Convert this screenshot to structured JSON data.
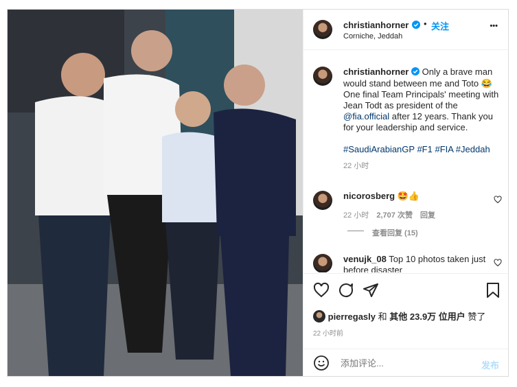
{
  "header": {
    "username": "christianhorner",
    "follow_label": "关注",
    "separator": "•",
    "location": "Corniche, Jeddah",
    "more": "•••"
  },
  "caption": {
    "username": "christianhorner",
    "text_before": "Only a brave man would stand between me and Toto 😂 One final Team Principals' meeting with Jean Todt as president of the ",
    "mention": "@fia.official",
    "text_after": " after 12 years. Thank you for your leadership and service.",
    "hashtags": "#SaudiArabianGP #F1 #FIA #Jeddah",
    "time": "22 小时"
  },
  "comments": [
    {
      "username": "nicorosberg",
      "text": "🤩👍",
      "time": "22 小时",
      "likes": "2,707 次赞",
      "reply": "回复",
      "view_replies": "查看回复 (15)"
    },
    {
      "username": "venujk_08",
      "text": "Top 10 photos taken just before disaster"
    }
  ],
  "likes": {
    "username": "pierregasly",
    "and": "和",
    "others": "其他 23.9万 位用户",
    "suffix": "赞了",
    "time": "22 小时前"
  },
  "comment_box": {
    "placeholder": "添加评论...",
    "post_label": "发布"
  },
  "colors": {
    "verified": "#0095f6",
    "follow": "#0095f6",
    "post_disabled": "#b2dffc"
  }
}
